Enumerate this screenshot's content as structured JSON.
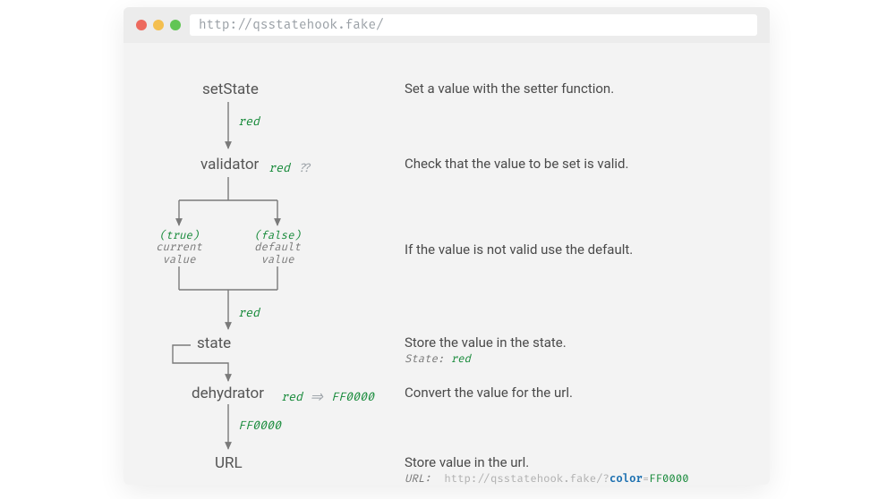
{
  "window": {
    "url": "http://qsstatehook.fake/",
    "lights": {
      "red": "#ed6a5e",
      "yellow": "#f4bf4f",
      "green": "#61c554"
    }
  },
  "nodes": {
    "setState": "setState",
    "validator": "validator",
    "state": "state",
    "dehydrator": "dehydrator",
    "url": "URL"
  },
  "edges": {
    "setState_validator": "red",
    "validator_annot_value": "red",
    "validator_annot_qq": "??",
    "branch_true": "(true)",
    "branch_true_sub": "current\nvalue",
    "branch_false": "(false)",
    "branch_false_sub": "default\nvalue",
    "branches_state": "red",
    "dehydrator_annot_in": "red",
    "dehydrator_annot_arrow": "=>",
    "dehydrator_annot_out": "FF0000",
    "dehydrator_url": "FF0000"
  },
  "descriptions": {
    "setState": "Set a value with the setter function.",
    "validator": "Check that the value to be set is valid.",
    "branches": "If the value is not valid use the default.",
    "state": "Store the value in the state.",
    "state_sub_label": "State:",
    "state_sub_value": "red",
    "dehydrator": "Convert the value for the url.",
    "url": "Store value in the url.",
    "url_sub_label": "URL:",
    "url_sub_base": "http://qsstatehook.fake/?",
    "url_sub_key": "color",
    "url_sub_eq": "=",
    "url_sub_val": "FF0000"
  }
}
